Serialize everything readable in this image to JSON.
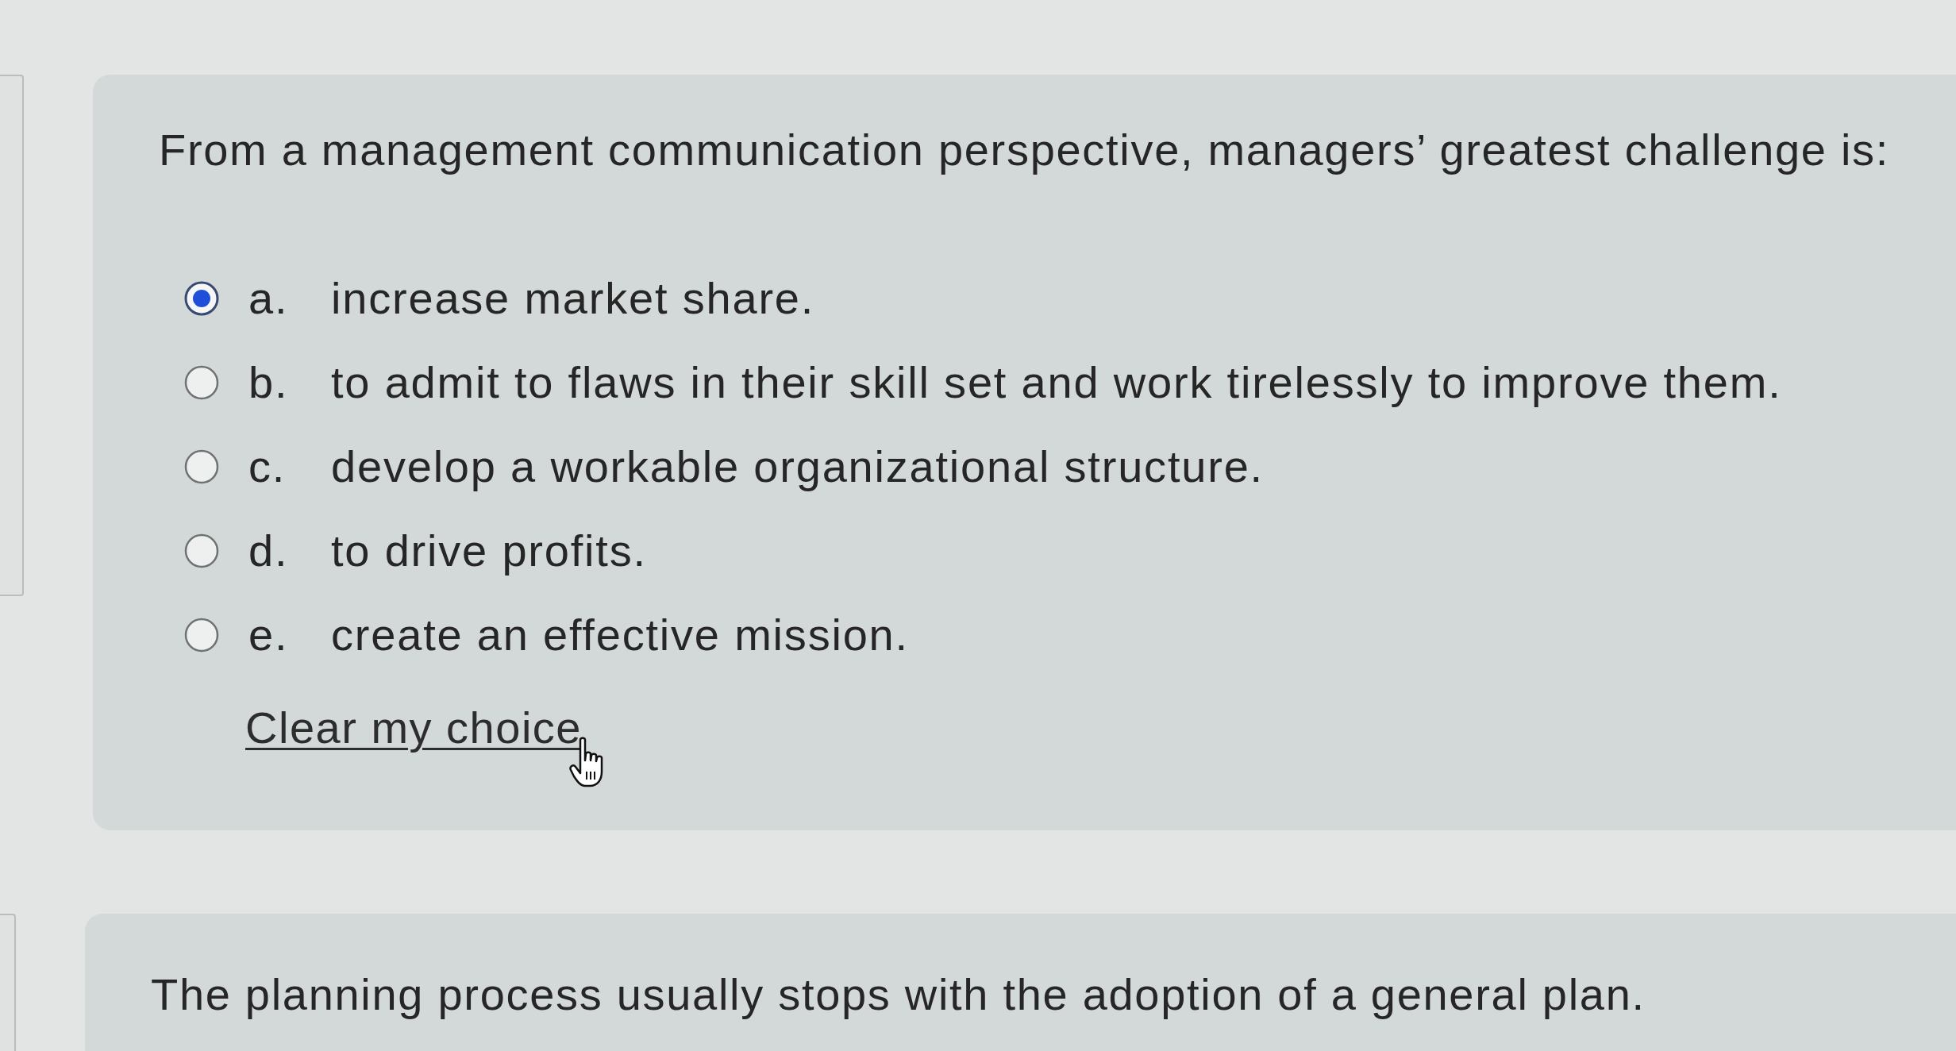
{
  "questions": [
    {
      "prompt": "From a management communication perspective, managers’ greatest challenge is:",
      "options": [
        {
          "letter": "a.",
          "text": "increase market share.",
          "selected": true
        },
        {
          "letter": "b.",
          "text": "to admit to flaws in their skill set and work tirelessly to improve them.",
          "selected": false
        },
        {
          "letter": "c.",
          "text": "develop a workable organizational structure.",
          "selected": false
        },
        {
          "letter": "d.",
          "text": "to drive profits.",
          "selected": false
        },
        {
          "letter": "e.",
          "text": "create an effective mission.",
          "selected": false
        }
      ],
      "clear_link": "Clear my choice"
    },
    {
      "prompt": "The planning process usually stops with the adoption of a general plan."
    }
  ]
}
